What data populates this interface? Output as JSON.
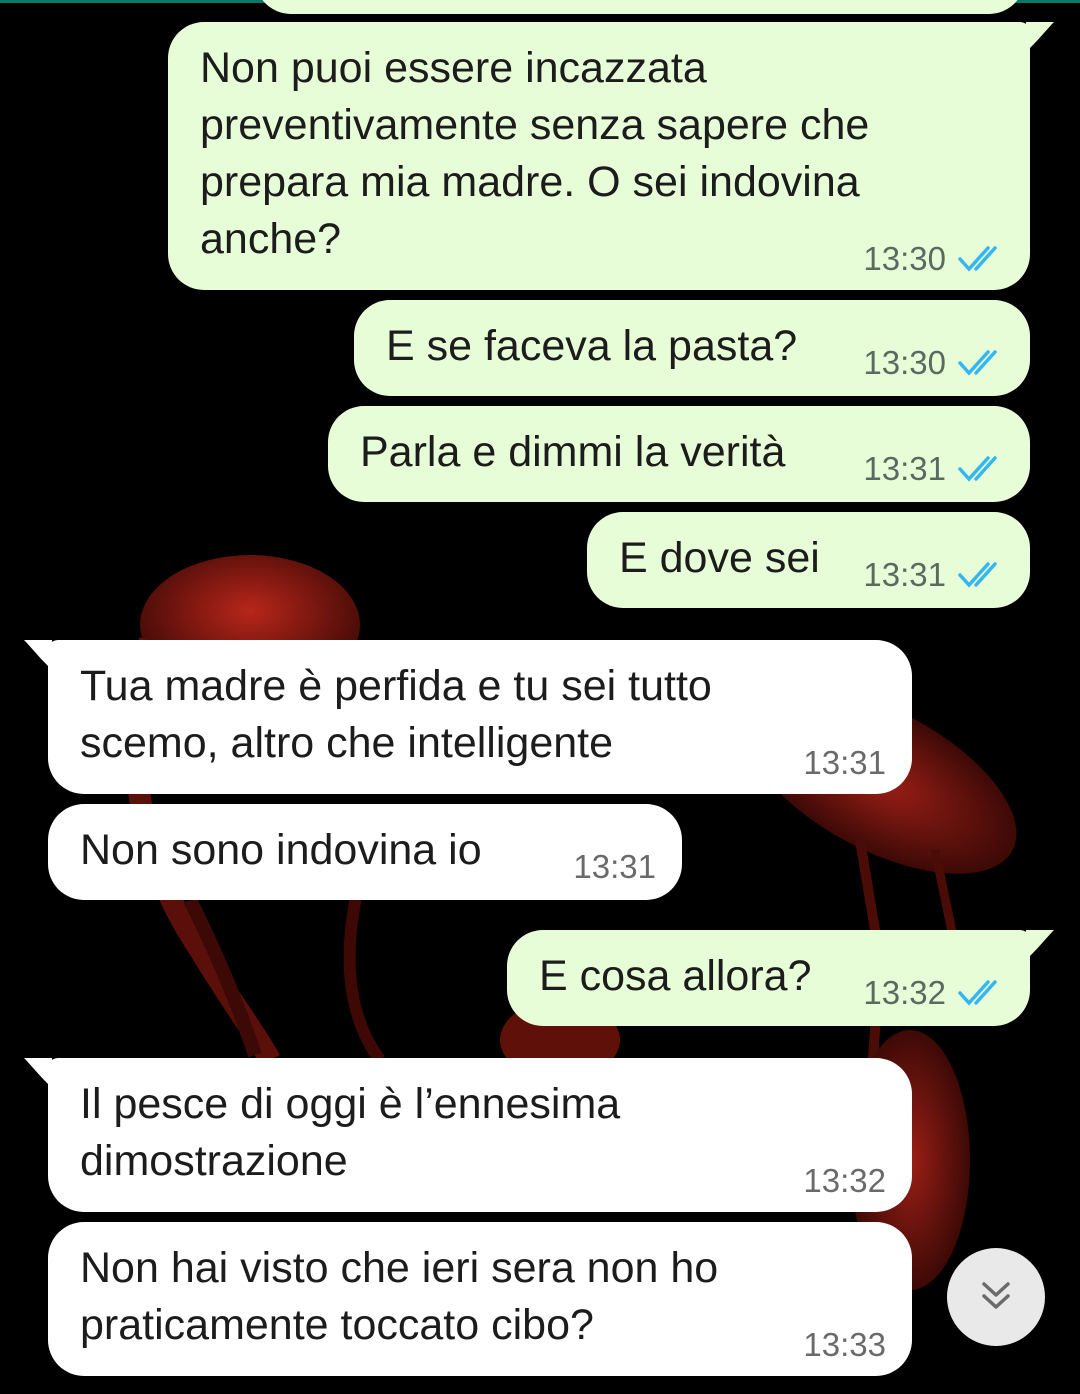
{
  "messages": [
    {
      "direction": "outgoing",
      "lines": [
        "Non puoi essere incazzata",
        "preventivamente senza sapere che",
        "prepara mia madre. O sei indovina",
        "anche?"
      ],
      "time": "13:30",
      "status": "read"
    },
    {
      "direction": "outgoing",
      "lines": [
        "E se faceva la pasta?"
      ],
      "time": "13:30",
      "status": "read"
    },
    {
      "direction": "outgoing",
      "lines": [
        "Parla e dimmi la verità"
      ],
      "time": "13:31",
      "status": "read"
    },
    {
      "direction": "outgoing",
      "lines": [
        "E dove sei"
      ],
      "time": "13:31",
      "status": "read"
    },
    {
      "direction": "incoming",
      "lines": [
        "Tua madre è perfida e tu sei tutto",
        "scemo, altro che intelligente"
      ],
      "time": "13:31"
    },
    {
      "direction": "incoming",
      "lines": [
        "Non sono indovina io"
      ],
      "time": "13:31"
    },
    {
      "direction": "outgoing",
      "lines": [
        "E cosa allora?"
      ],
      "time": "13:32",
      "status": "read"
    },
    {
      "direction": "incoming",
      "lines": [
        "Il pesce di oggi è l’ennesima",
        "dimostrazione"
      ],
      "time": "13:32"
    },
    {
      "direction": "incoming",
      "lines": [
        "Non hai visto che ieri sera non ho",
        "praticamente toccato cibo?"
      ],
      "time": "13:33"
    }
  ],
  "icons": {
    "read_receipt": "double-check-icon",
    "scroll_down": "chevron-double-down-icon"
  },
  "colors": {
    "outgoing_bubble": "#e7fdd8",
    "incoming_bubble": "#ffffff",
    "read_tick": "#34b7f1",
    "wallpaper": "#000000",
    "wallpaper_flamingo": "#8e1b14",
    "header_accent": "#0a7a68"
  }
}
